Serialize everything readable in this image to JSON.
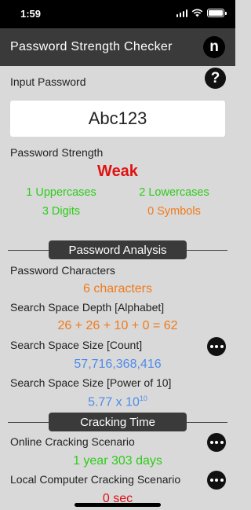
{
  "status_bar": {
    "time": "1:59"
  },
  "header": {
    "title": "Password Strength Checker",
    "logo_letter": "n"
  },
  "input": {
    "label": "Input Password",
    "value": "Abc123",
    "help_symbol": "?"
  },
  "strength": {
    "label": "Password Strength",
    "value": "Weak",
    "uppercases": "1 Uppercases",
    "lowercases": "2 Lowercases",
    "digits": "3 Digits",
    "symbols": "0 Symbols"
  },
  "analysis": {
    "section_title": "Password Analysis",
    "characters_label": "Password Characters",
    "characters_value": "6 characters",
    "depth_label": "Search Space Depth [Alphabet]",
    "depth_value": "26 + 26 + 10 + 0 = 62",
    "size_count_label": "Search Space Size [Count]",
    "size_count_value": "57,716,368,416",
    "size_power_label": "Search Space Size [Power of 10]",
    "size_power_mantissa": "5.77 x 10",
    "size_power_exponent": "10"
  },
  "cracking": {
    "section_title": "Cracking Time",
    "online_label": "Online Cracking Scenario",
    "online_value": "1 year 303 days",
    "local_label": "Local Computer Cracking Scenario",
    "local_value": "0 sec"
  },
  "colors": {
    "weak": "#e01212",
    "green": "#2ecc1a",
    "orange": "#f07a1a",
    "blue": "#4f8bea",
    "header": "#3a3a3a"
  }
}
